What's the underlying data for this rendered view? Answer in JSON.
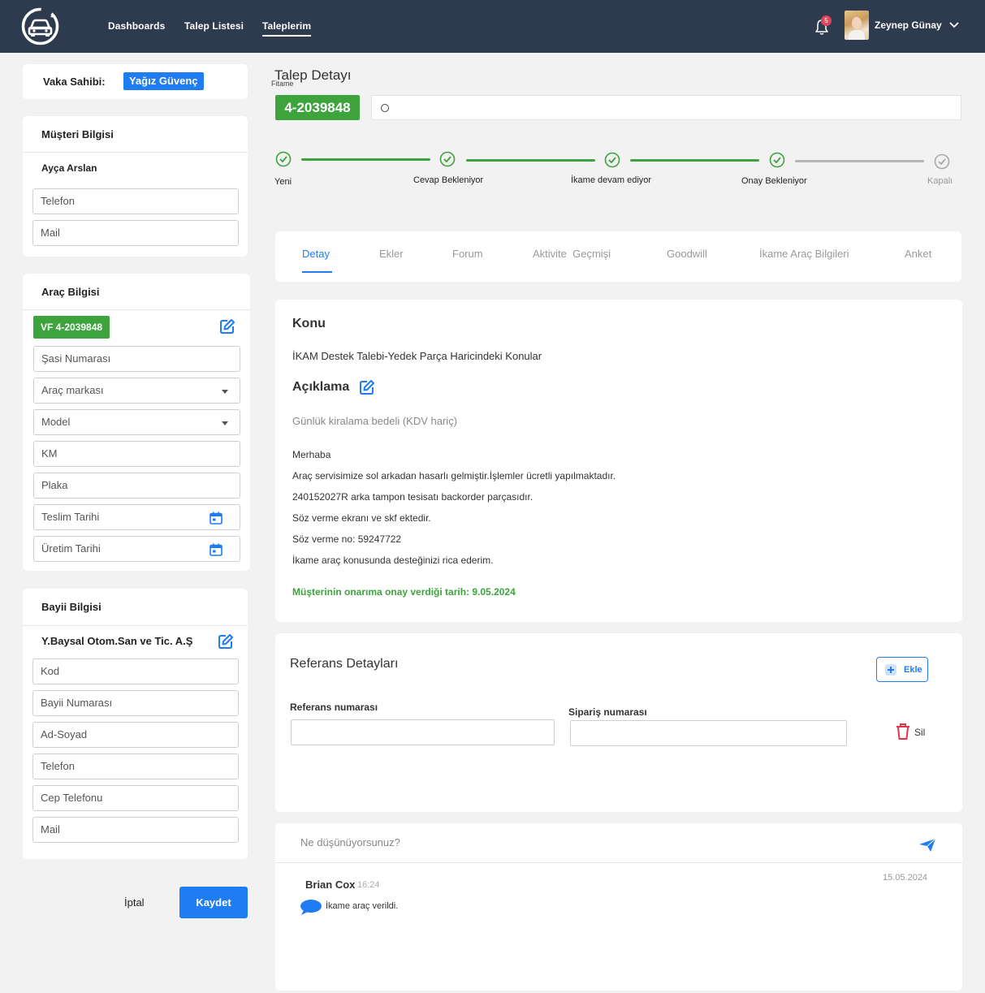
{
  "nav": {
    "items": [
      "Dashboards",
      "Talep Listesi",
      "Taleplerim"
    ],
    "active": "Taleplerim"
  },
  "header": {
    "notification_count": "5",
    "user_name": "Zeynep Günay"
  },
  "case_owner": {
    "label": "Vaka Sahibi:",
    "value": "Yağız Güvenç"
  },
  "customer": {
    "title": "Müşteri Bilgisi",
    "name": "Ayça Arslan",
    "phone_placeholder": "Telefon",
    "mail_placeholder": "Mail"
  },
  "vehicle": {
    "title": "Araç Bilgisi",
    "badge": "VF 4-2039848",
    "chassis": "Şasi Numarası",
    "brand": "Araç markası",
    "model": "Model",
    "km": "KM",
    "plate": "Plaka",
    "delivery_date": "Teslim Tarihi",
    "production_date": "Üretim Tarihi"
  },
  "dealer": {
    "title": "Bayii Bilgisi",
    "name": "Y.Baysal Otom.San ve Tic. A.Ş",
    "code": "Kod",
    "dealer_number": "Bayii Numarası",
    "full_name": "Ad-Soyad",
    "phone": "Telefon",
    "mobile": "Cep Telefonu",
    "mail": "Mail"
  },
  "actions": {
    "cancel": "İptal",
    "save": "Kaydet"
  },
  "detail": {
    "title": "Talep Detayı",
    "subtitle": "Fitame",
    "ticket_id": "4-2039848"
  },
  "progress": {
    "steps": [
      {
        "label": "Yeni",
        "done": true
      },
      {
        "label": "Cevap Bekleniyor",
        "done": true
      },
      {
        "label": "İkame devam ediyor",
        "done": true
      },
      {
        "label": "Onay Bekleniyor",
        "done": true
      },
      {
        "label": "Kapalı",
        "done": false
      }
    ],
    "colors": {
      "done": "#3da33d",
      "pending": "#b5b5b5"
    }
  },
  "tabs": [
    "Detay",
    "Ekler",
    "Forum",
    "Aktivite  Geçmişi",
    "Goodwill",
    "İkame Araç Bilgileri",
    "Anket"
  ],
  "content": {
    "subject_title": "Konu",
    "subject": "İKAM Destek Talebi-Yedek Parça Haricindeki Konular",
    "description_title": "Açıklama",
    "description_hint": "Günlük kiralama bedeli (KDV hariç)",
    "lines": [
      "Merhaba",
      "Araç servisimize sol arkadan hasarlı gelmiştir.İşlemler ücretli yapılmaktadır.",
      "240152027R arka tampon tesisatı backorder parçasıdır.",
      "Söz verme ekranı ve skf ektedir.",
      "Söz verme no: 59247722",
      "İkame araç konusunda desteğinizi rica ederim."
    ],
    "approval": "Müşterinin onarıma onay verdiği tarih: 9.05.2024"
  },
  "references": {
    "title": "Referans Detayları",
    "add": "Ekle",
    "ref_label": "Referans numarası",
    "order_label": "Sipariş numarası",
    "delete": "Sil"
  },
  "comments": {
    "placeholder": "Ne düşünüyorsunuz?",
    "items": [
      {
        "author": "Brian Cox",
        "time": "16:24",
        "date": "15.05.2024",
        "text": "İkame araç verildi."
      }
    ]
  },
  "colors": {
    "topbar": "#2e3b4e",
    "primary": "#1f7cf2",
    "success": "#3da33d"
  }
}
